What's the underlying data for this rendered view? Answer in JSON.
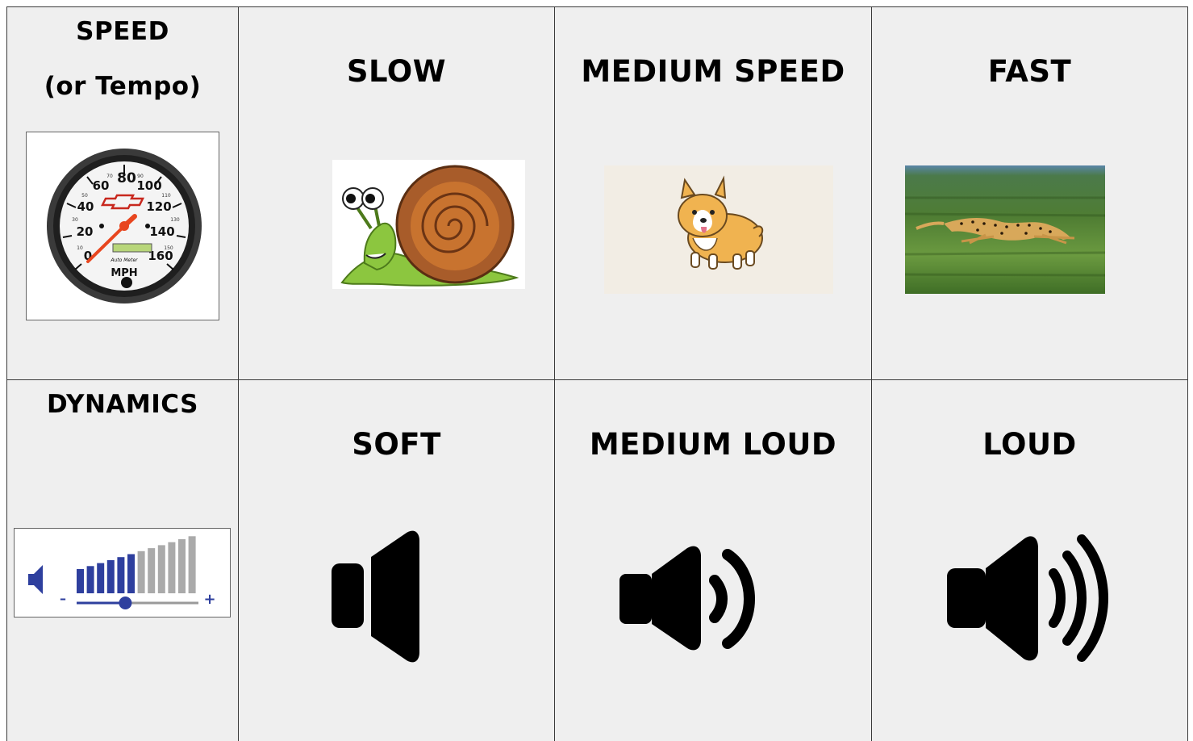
{
  "rows": [
    {
      "header_lines": [
        "SPEED",
        "(or Tempo)"
      ],
      "header_icon": "speedometer-icon",
      "columns": [
        {
          "label": "SLOW",
          "icon": "snail-icon"
        },
        {
          "label": "MEDIUM SPEED",
          "icon": "corgi-icon"
        },
        {
          "label": "FAST",
          "icon": "cheetah-icon"
        }
      ]
    },
    {
      "header_lines": [
        "DYNAMICS"
      ],
      "header_icon": "volume-slider-icon",
      "columns": [
        {
          "label": "SOFT",
          "icon": "speaker-soft-icon"
        },
        {
          "label": "MEDIUM LOUD",
          "icon": "speaker-medium-icon"
        },
        {
          "label": "LOUD",
          "icon": "speaker-loud-icon"
        }
      ]
    }
  ],
  "speedometer": {
    "ticks": [
      "0",
      "20",
      "40",
      "60",
      "80",
      "100",
      "120",
      "140",
      "160"
    ],
    "minor_ticks": [
      "10",
      "30",
      "50",
      "70",
      "90",
      "110",
      "130",
      "150"
    ],
    "unit": "MPH",
    "brand": "Auto Meter"
  },
  "volume_slider": {
    "minus": "–",
    "plus": "+",
    "level": 0.4
  },
  "colors": {
    "cell_bg": "#efefef",
    "border": "#3a3a3a",
    "text": "#000000",
    "slider_blue": "#2e3f9e"
  }
}
